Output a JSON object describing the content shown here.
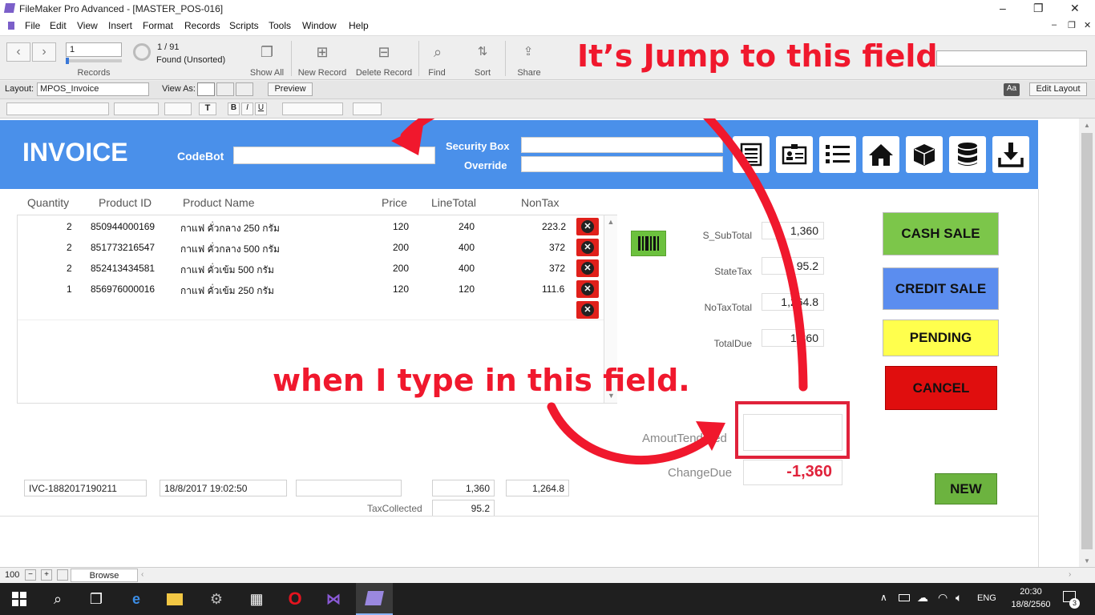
{
  "window": {
    "title": "FileMaker Pro Advanced - [MASTER_POS-016]",
    "controls": [
      "–",
      "❐",
      "✕"
    ]
  },
  "menu": [
    "File",
    "Edit",
    "View",
    "Insert",
    "Format",
    "Records",
    "Scripts",
    "Tools",
    "Window",
    "Help"
  ],
  "toolbar": {
    "record_number": "1",
    "records_label": "Records",
    "found_count": "1 / 91",
    "found_status": "Found (Unsorted)",
    "show_all": "Show All",
    "new_record": "New Record",
    "delete_record": "Delete Record",
    "find": "Find",
    "sort": "Sort",
    "share": "Share"
  },
  "layoutbar": {
    "layout_label": "Layout:",
    "layout_value": "MPOS_Invoice",
    "view_as": "View As:",
    "preview": "Preview",
    "aa": "Aa",
    "edit_layout": "Edit Layout"
  },
  "header": {
    "title": "INVOICE",
    "codebot_label": "CodeBot",
    "security_box_label": "Security Box",
    "override_label": "Override",
    "icons": [
      "report-icon",
      "id-card-icon",
      "list-icon",
      "home-icon",
      "box-icon",
      "database-icon",
      "download-icon"
    ]
  },
  "table": {
    "columns": [
      "Quantity",
      "Product ID",
      "Product Name",
      "Price",
      "LineTotal",
      "NonTax"
    ],
    "rows": [
      {
        "qty": "2",
        "product_id": "850944000169",
        "name": "กาแฟ คั่วกลาง 250 กรัม",
        "price": "120",
        "line_total": "240",
        "nontax": "223.2"
      },
      {
        "qty": "2",
        "product_id": "851773216547",
        "name": "กาแฟ คั่วกลาง 500 กรัม",
        "price": "200",
        "line_total": "400",
        "nontax": "372"
      },
      {
        "qty": "2",
        "product_id": "852413434581",
        "name": "กาแฟ คั่วเข้ม 500 กรัม",
        "price": "200",
        "line_total": "400",
        "nontax": "372"
      },
      {
        "qty": "1",
        "product_id": "856976000016",
        "name": "กาแฟ คั่วเข้ม 250 กรัม",
        "price": "120",
        "line_total": "120",
        "nontax": "111.6"
      }
    ]
  },
  "summary": {
    "subtotal_label": "S_SubTotal",
    "subtotal_value": "1,360",
    "statetax_label": "StateTax",
    "statetax_value": "95.2",
    "notaxtotal_label": "NoTaxTotal",
    "notaxtotal_value": "1,264.8",
    "totaldue_label": "TotalDue",
    "totaldue_value": "1,360",
    "amount_tendered_label": "AmoutTendered",
    "amount_tendered_value": "",
    "change_due_label": "ChangeDue",
    "change_due_value": "-1,360"
  },
  "actions": {
    "cash_sale": "CASH SALE",
    "credit_sale": "CREDIT SALE",
    "pending": "PENDING",
    "cancel": "CANCEL",
    "new": "NEW"
  },
  "footer": {
    "invoice_id": "IVC-1882017190211",
    "datetime": "18/8/2017 19:02:50",
    "blank": "",
    "total": "1,360",
    "notax": "1,264.8",
    "tax_collected_label": "TaxCollected",
    "tax_collected": "95.2"
  },
  "annotations": {
    "jump": "It’s Jump to this field",
    "type": "when I type in this field."
  },
  "statusbar": {
    "zoom": "100",
    "mode": "Browse"
  },
  "taskbar": {
    "lang": "ENG",
    "time": "20:30",
    "date": "18/8/2560",
    "notifications": "3"
  },
  "colors": {
    "header_blue": "#4a90ea",
    "cash_sale": "#7cc64a",
    "credit_sale": "#5b8def",
    "pending": "#ffff4d",
    "cancel": "#e00e0e",
    "new_button": "#6cb33f",
    "annotation_red": "#f0182d"
  }
}
